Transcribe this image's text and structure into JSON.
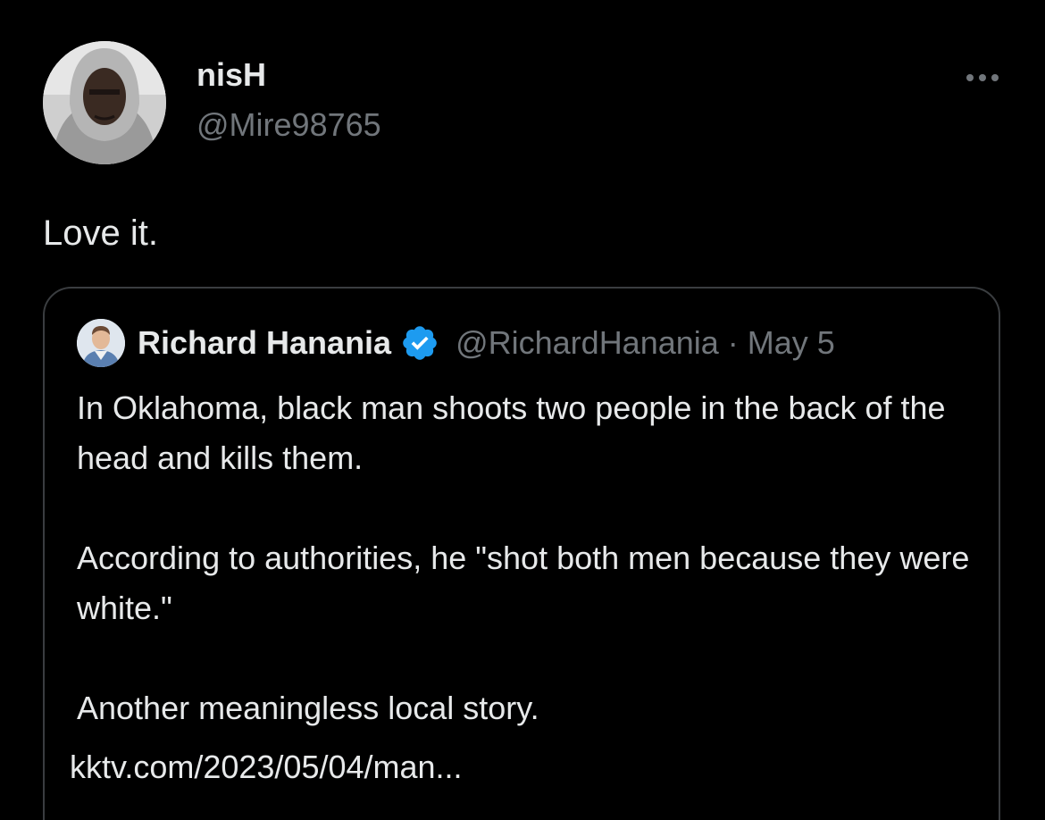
{
  "tweet": {
    "author_name": "nisH",
    "author_handle": "@Mire98765",
    "text": "Love it.",
    "more_icon": "more-horizontal-icon"
  },
  "quoted_tweet": {
    "author_name": "Richard Hanania",
    "verified_icon": "verified-badge-icon",
    "author_handle": "@RichardHanania",
    "separator": "·",
    "date": "May 5",
    "paragraphs": [
      "In Oklahoma, black man shoots two people in the back of the head and kills them.",
      "According to authorities, he \"shot both men because they were white.\"",
      "Another meaningless local story."
    ],
    "link_text": "kktv.com/2023/05/04/man..."
  },
  "colors": {
    "background": "#000000",
    "primary_text": "#e7e9ea",
    "secondary_text": "#71767b",
    "card_border": "#3a3d40",
    "verified_blue": "#1d9bf0"
  }
}
